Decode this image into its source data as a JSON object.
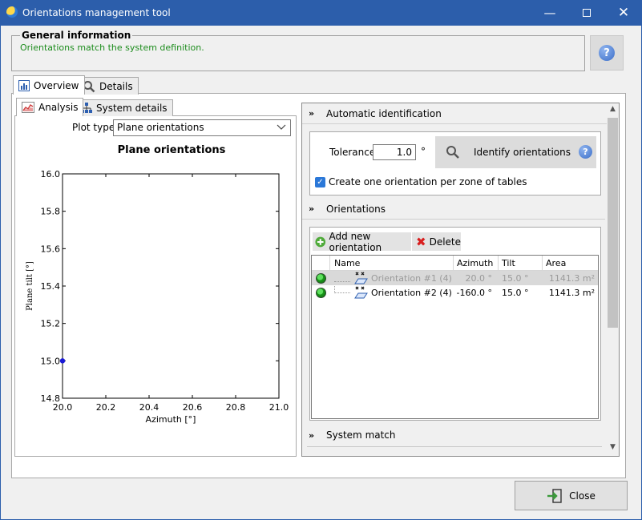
{
  "window": {
    "title": "Orientations management tool"
  },
  "general_info": {
    "title": "General information",
    "message": "Orientations match the system definition."
  },
  "main_tabs": [
    {
      "label": "Overview",
      "active": true
    },
    {
      "label": "Details",
      "active": false
    }
  ],
  "sub_tabs": [
    {
      "label": "Analysis",
      "active": true
    },
    {
      "label": "System details",
      "active": false
    }
  ],
  "plot": {
    "type_label": "Plot type",
    "type_value": "Plane orientations"
  },
  "chart_data": {
    "type": "scatter",
    "title": "Plane orientations",
    "xlabel": "Azimuth [°]",
    "ylabel": "Plane tilt [°]",
    "xlim": [
      20.0,
      21.0
    ],
    "ylim": [
      14.8,
      16.0
    ],
    "x_ticks": [
      "20.0",
      "20.2",
      "20.4",
      "20.6",
      "20.8",
      "21.0"
    ],
    "y_ticks": [
      "16.0",
      "15.8",
      "15.6",
      "15.4",
      "15.2",
      "15.0",
      "14.8"
    ],
    "points": [
      {
        "x": 20.0,
        "y": 15.0
      }
    ],
    "point_color": "#1a1ad6"
  },
  "auto_identification": {
    "title": "Automatic identification",
    "tolerance_label": "Tolerance",
    "tolerance_value": "1.0",
    "tolerance_unit": "°",
    "identify_label": "Identify orientations",
    "checkbox_label": "Create one orientation per zone of tables",
    "checkbox_checked": true
  },
  "orientations": {
    "title": "Orientations",
    "add_label": "Add new orientation",
    "delete_label": "Delete",
    "columns": [
      "Name",
      "Azimuth",
      "Tilt",
      "Area"
    ],
    "rows": [
      {
        "name": "Orientation #1 (4)",
        "azimuth": "20.0 °",
        "tilt": "15.0 °",
        "area": "1141.3 m²",
        "selected": true
      },
      {
        "name": "Orientation #2 (4)",
        "azimuth": "-160.0 °",
        "tilt": "15.0 °",
        "area": "1141.3 m²",
        "selected": false
      }
    ]
  },
  "system_match": {
    "title": "System match"
  },
  "close_label": "Close"
}
